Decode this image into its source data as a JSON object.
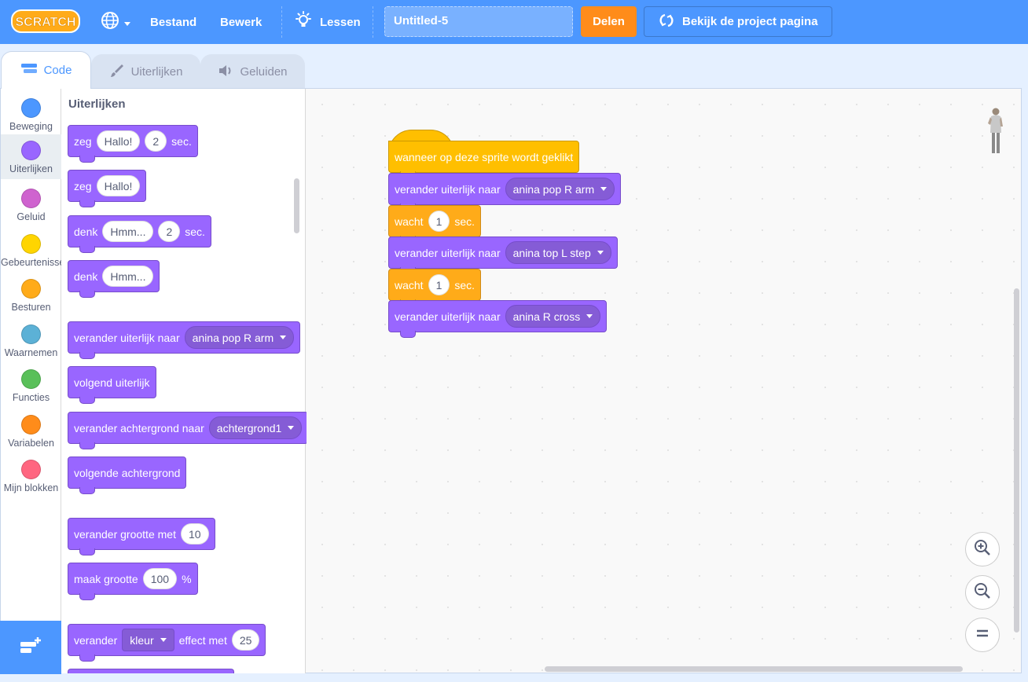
{
  "menubar": {
    "logo_text": "SCRATCH",
    "file_label": "Bestand",
    "edit_label": "Bewerk",
    "tutorials_label": "Lessen",
    "project_title": "Untitled-5",
    "share_label": "Delen",
    "project_page_label": "Bekijk de project pagina"
  },
  "tabs": [
    {
      "label": "Code",
      "active": true
    },
    {
      "label": "Uiterlijken",
      "active": false
    },
    {
      "label": "Geluiden",
      "active": false
    }
  ],
  "categories": [
    {
      "label": "Beweging",
      "color": "#4c97ff"
    },
    {
      "label": "Uiterlijken",
      "color": "#9966ff",
      "selected": true
    },
    {
      "label": "Geluid",
      "color": "#cf63cf"
    },
    {
      "label": "Gebeurtenissen",
      "color": "#ffd500"
    },
    {
      "label": "Besturen",
      "color": "#ffab19"
    },
    {
      "label": "Waarnemen",
      "color": "#5cb1d6"
    },
    {
      "label": "Functies",
      "color": "#59c059"
    },
    {
      "label": "Variabelen",
      "color": "#ff8c1a"
    },
    {
      "label": "Mijn blokken",
      "color": "#ff6680"
    }
  ],
  "palette": {
    "heading": "Uiterlijken",
    "say_secs": {
      "text": "zeg",
      "message": "Hallo!",
      "secs": "2",
      "unit": "sec."
    },
    "say": {
      "text": "zeg",
      "message": "Hallo!"
    },
    "think_secs": {
      "text": "denk",
      "message": "Hmm...",
      "secs": "2",
      "unit": "sec."
    },
    "think": {
      "text": "denk",
      "message": "Hmm..."
    },
    "switch_costume": {
      "text": "verander uiterlijk naar",
      "costume": "anina pop R arm"
    },
    "next_costume": {
      "text": "volgend uiterlijk"
    },
    "switch_backdrop": {
      "text": "verander achtergrond naar",
      "backdrop": "achtergrond1"
    },
    "next_backdrop": {
      "text": "volgende achtergrond"
    },
    "change_size": {
      "text": "verander grootte met",
      "value": "10"
    },
    "set_size": {
      "text": "maak grootte",
      "value": "100",
      "unit": "%"
    },
    "change_effect": {
      "text_before": "verander",
      "effect": "kleur",
      "text_after": "effect met",
      "value": "25"
    }
  },
  "script": {
    "hat": "wanneer op deze sprite wordt geklikt",
    "switch1": {
      "text": "verander uiterlijk naar",
      "costume": "anina pop R arm"
    },
    "wait1": {
      "text": "wacht",
      "value": "1",
      "unit": "sec."
    },
    "switch2": {
      "text": "verander uiterlijk naar",
      "costume": "anina top L step"
    },
    "wait2": {
      "text": "wacht",
      "value": "1",
      "unit": "sec."
    },
    "switch3": {
      "text": "verander uiterlijk naar",
      "costume": "anina R cross"
    }
  },
  "icons": {
    "globe": "globe-icon",
    "lightbulb": "lightbulb-icon",
    "remix": "remix-arrows-icon",
    "code": "code-blocks-icon",
    "brush": "paintbrush-icon",
    "speaker": "speaker-icon",
    "zoom_in": "zoom-in-icon",
    "zoom_out": "zoom-out-icon",
    "zoom_reset": "zoom-reset-icon",
    "extension": "add-extension-icon"
  }
}
